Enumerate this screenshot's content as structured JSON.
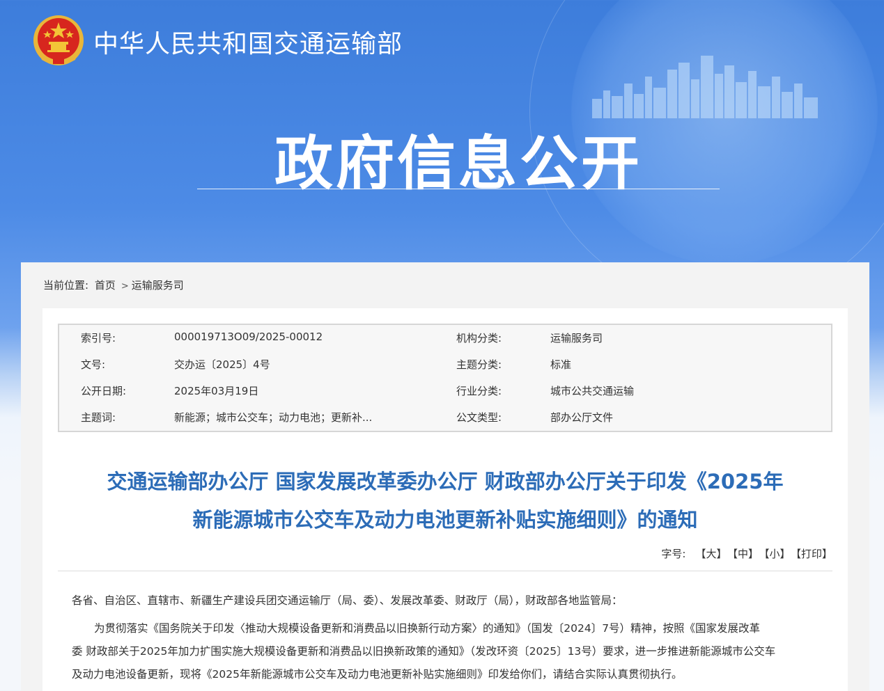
{
  "header": {
    "site_title": "中华人民共和国交通运输部",
    "section_title": "政府信息公开"
  },
  "breadcrumb": {
    "label": "当前位置:",
    "items": [
      "首页",
      "运输服务司"
    ],
    "separator": ">"
  },
  "meta": {
    "rows": [
      {
        "label1": "索引号:",
        "value1": "000019713O09/2025-00012",
        "label2": "机构分类:",
        "value2": "运输服务司"
      },
      {
        "label1": "文号:",
        "value1": "交办运〔2025〕4号",
        "label2": "主题分类:",
        "value2": "标准"
      },
      {
        "label1": "公开日期:",
        "value1": "2025年03月19日",
        "label2": "行业分类:",
        "value2": "城市公共交通运输"
      },
      {
        "label1": "主题词:",
        "value1": "新能源；城市公交车；动力电池；更新补...",
        "label2": "公文类型:",
        "value2": "部办公厅文件"
      }
    ]
  },
  "document": {
    "title_line1": "交通运输部办公厅 国家发展改革委办公厅 财政部办公厅关于印发《2025年",
    "title_line2": "新能源城市公交车及动力电池更新补贴实施细则》的通知"
  },
  "toolbar": {
    "font_label": "字号:",
    "large": "【大】",
    "medium": "【中】",
    "small": "【小】",
    "print": "【打印】"
  },
  "body": {
    "salutation": "各省、自治区、直辖市、新疆生产建设兵团交通运输厅（局、委）、发展改革委、财政厅（局），财政部各地监管局：",
    "para_line1": "为贯彻落实《国务院关于印发〈推动大规模设备更新和消费品以旧换新行动方案〉的通知》（国发〔2024〕7号）精神，按照《国家发展改革",
    "para_line2": "委 财政部关于2025年加力扩围实施大规模设备更新和消费品以旧换新政策的通知》（发改环资〔2025〕13号）要求，进一步推进新能源城市公交车",
    "para_line3": "及动力电池设备更新，现将《2025年新能源城市公交车及动力电池更新补贴实施细则》印发给你们，请结合实际认真贯彻执行。"
  },
  "colors": {
    "banner_blue": "#4d8be6",
    "title_blue": "#2c6cb7",
    "emblem_red": "#d7261e",
    "emblem_gold": "#f3c437"
  },
  "icons": {
    "emblem": "national-emblem-icon",
    "skyline": "city-skyline-decoration"
  }
}
